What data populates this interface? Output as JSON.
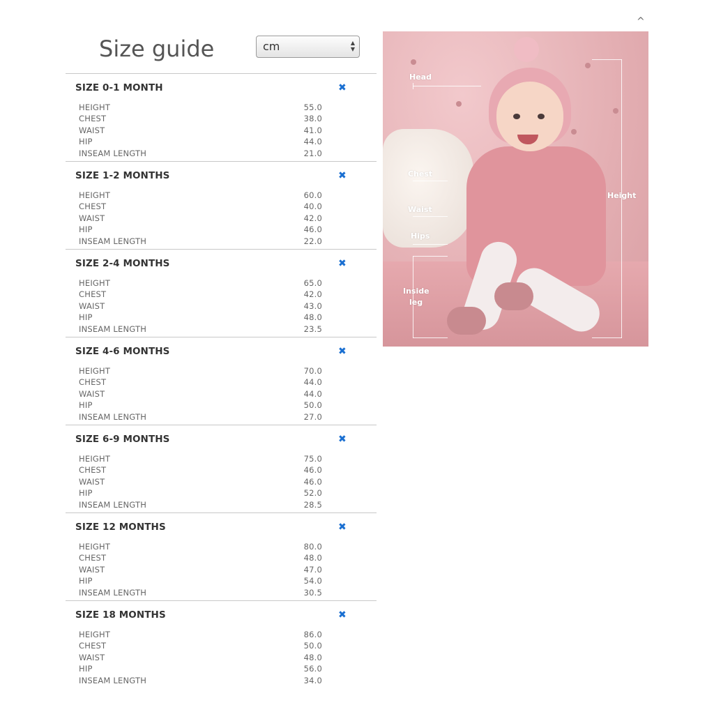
{
  "header": {
    "title": "Size guide",
    "unit_select": {
      "value": "cm",
      "options": [
        "cm"
      ]
    }
  },
  "collapse_caret": "^",
  "close_glyph": "✖",
  "sizes": [
    {
      "title": "SIZE 0-1 MONTH",
      "rows": [
        {
          "label": "HEIGHT",
          "value": "55.0"
        },
        {
          "label": "CHEST",
          "value": "38.0"
        },
        {
          "label": "WAIST",
          "value": "41.0"
        },
        {
          "label": "HIP",
          "value": "44.0"
        },
        {
          "label": "INSEAM LENGTH",
          "value": "21.0"
        }
      ]
    },
    {
      "title": "SIZE 1-2 MONTHS",
      "rows": [
        {
          "label": "HEIGHT",
          "value": "60.0"
        },
        {
          "label": "CHEST",
          "value": "40.0"
        },
        {
          "label": "WAIST",
          "value": "42.0"
        },
        {
          "label": "HIP",
          "value": "46.0"
        },
        {
          "label": "INSEAM LENGTH",
          "value": "22.0"
        }
      ]
    },
    {
      "title": "SIZE 2-4 MONTHS",
      "rows": [
        {
          "label": "HEIGHT",
          "value": "65.0"
        },
        {
          "label": "CHEST",
          "value": "42.0"
        },
        {
          "label": "WAIST",
          "value": "43.0"
        },
        {
          "label": "HIP",
          "value": "48.0"
        },
        {
          "label": "INSEAM LENGTH",
          "value": "23.5"
        }
      ]
    },
    {
      "title": "SIZE 4-6 MONTHS",
      "rows": [
        {
          "label": "HEIGHT",
          "value": "70.0"
        },
        {
          "label": "CHEST",
          "value": "44.0"
        },
        {
          "label": "WAIST",
          "value": "44.0"
        },
        {
          "label": "HIP",
          "value": "50.0"
        },
        {
          "label": "INSEAM LENGTH",
          "value": "27.0"
        }
      ]
    },
    {
      "title": "SIZE 6-9 MONTHS",
      "rows": [
        {
          "label": "HEIGHT",
          "value": "75.0"
        },
        {
          "label": "CHEST",
          "value": "46.0"
        },
        {
          "label": "WAIST",
          "value": "46.0"
        },
        {
          "label": "HIP",
          "value": "52.0"
        },
        {
          "label": "INSEAM LENGTH",
          "value": "28.5"
        }
      ]
    },
    {
      "title": "SIZE 12 MONTHS",
      "rows": [
        {
          "label": "HEIGHT",
          "value": "80.0"
        },
        {
          "label": "CHEST",
          "value": "48.0"
        },
        {
          "label": "WAIST",
          "value": "47.0"
        },
        {
          "label": "HIP",
          "value": "54.0"
        },
        {
          "label": "INSEAM LENGTH",
          "value": "30.5"
        }
      ]
    },
    {
      "title": "SIZE 18 MONTHS",
      "rows": [
        {
          "label": "HEIGHT",
          "value": "86.0"
        },
        {
          "label": "CHEST",
          "value": "50.0"
        },
        {
          "label": "WAIST",
          "value": "48.0"
        },
        {
          "label": "HIP",
          "value": "56.0"
        },
        {
          "label": "INSEAM LENGTH",
          "value": "34.0"
        }
      ]
    }
  ],
  "photo": {
    "labels": {
      "head": "Head",
      "chest": "Chest",
      "waist": "Waist",
      "hips": "Hips",
      "inside_leg_1": "Inside",
      "inside_leg_2": "leg",
      "height": "Height"
    }
  },
  "colors": {
    "close_icon": "#1a6fd1",
    "divider": "#c8c8c8",
    "title": "#555555"
  }
}
